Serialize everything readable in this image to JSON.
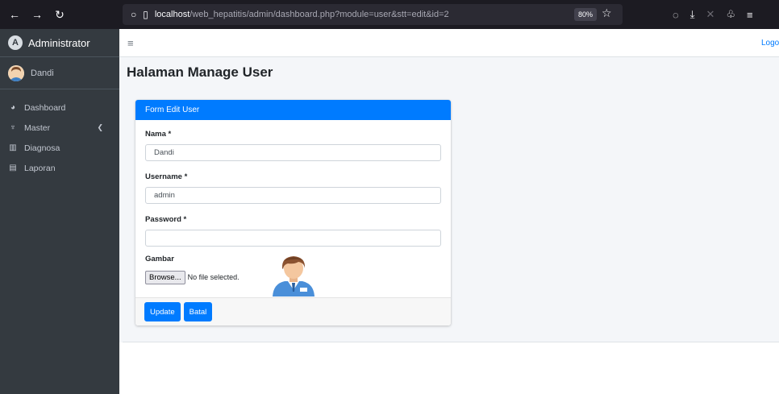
{
  "browser": {
    "url_host": "localhost",
    "url_path": "/web_hepatitis/admin/dashboard.php?module=user&stt=edit&id=2",
    "zoom": "80%"
  },
  "sidebar": {
    "brand": "Administrator",
    "user_name": "Dandi",
    "items": [
      {
        "label": "Dashboard",
        "icon": "dashboard-icon"
      },
      {
        "label": "Master",
        "icon": "master-icon"
      },
      {
        "label": "Diagnosa",
        "icon": "diagnosa-icon"
      },
      {
        "label": "Laporan",
        "icon": "laporan-icon"
      }
    ]
  },
  "header": {
    "logout_label": "Logo"
  },
  "page": {
    "title": "Halaman Manage User"
  },
  "form": {
    "header": "Form Edit User",
    "nama_label": "Nama *",
    "nama_value": "Dandi",
    "username_label": "Username *",
    "username_value": "admin",
    "password_label": "Password *",
    "password_value": "",
    "gambar_label": "Gambar",
    "browse_label": "Browse...",
    "file_status": "No file selected.",
    "update_label": "Update",
    "batal_label": "Batal"
  },
  "colors": {
    "primary": "#007bff",
    "sidebar_bg": "#343a40"
  }
}
